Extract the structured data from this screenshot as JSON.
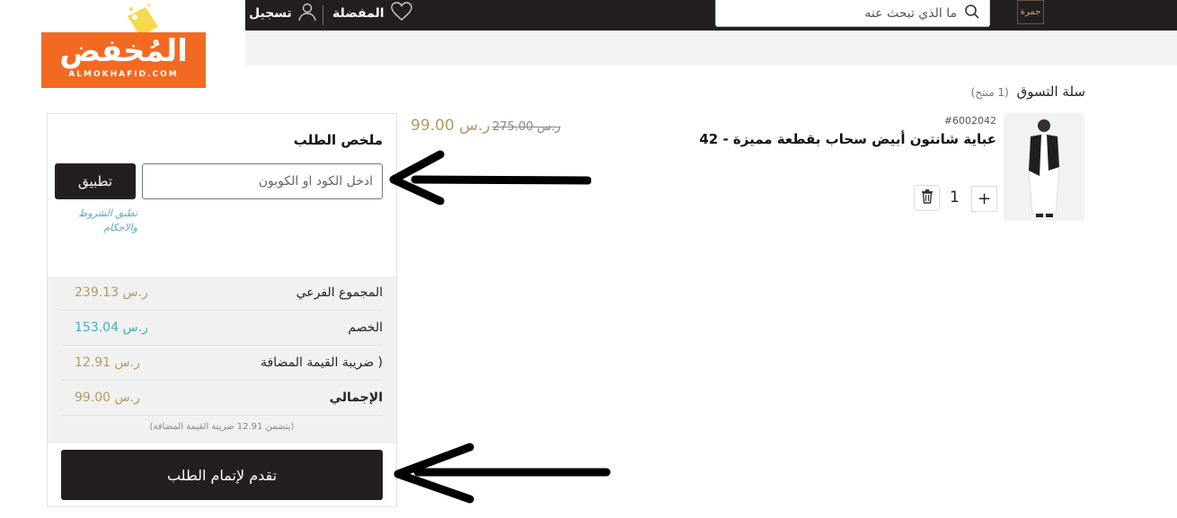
{
  "header": {
    "store_logo_text": "جمرة",
    "search_placeholder": "ما الذي تبحث عنه",
    "favorites_label": "المفضلة",
    "login_label": "تسجيل"
  },
  "watermark": {
    "arabic": "المُخفض",
    "english": "ALMOKHAFID.COM"
  },
  "cart": {
    "title": "سلة التسوق",
    "count": "(1 منتج)",
    "item": {
      "sku": "#6002042",
      "name": "عباية شانتون أبيض سحاب بقطعة مميزة - 42",
      "old_price": "ر.س 275.00",
      "price": "ر.س 99.00",
      "quantity": "1",
      "plus": "+"
    }
  },
  "summary": {
    "title": "ملخص الطلب",
    "coupon_placeholder": "ادخل الكود او الكوبون",
    "apply_label": "تطبيق",
    "terms": "تطبق الشروط والاحكام",
    "rows": [
      {
        "label": "المجموع الفرعي",
        "value": "ر.س 239.13"
      },
      {
        "label": "الخصم",
        "value": "ر.س 153.04"
      },
      {
        "label": "( ضريبة القيمة المضافة",
        "value": "ر.س 12.91"
      },
      {
        "label": "الإجمالي",
        "value": "ر.س 99.00"
      }
    ],
    "vat_note": "(يتضمن 12.91 ضريبة القيمة المضافة)",
    "checkout_label": "تقدم لإتمام الطلب"
  },
  "colors": {
    "dark": "#231f20",
    "gold": "#b39a63",
    "teal": "#3bb3c3",
    "orange": "#f26a21"
  }
}
